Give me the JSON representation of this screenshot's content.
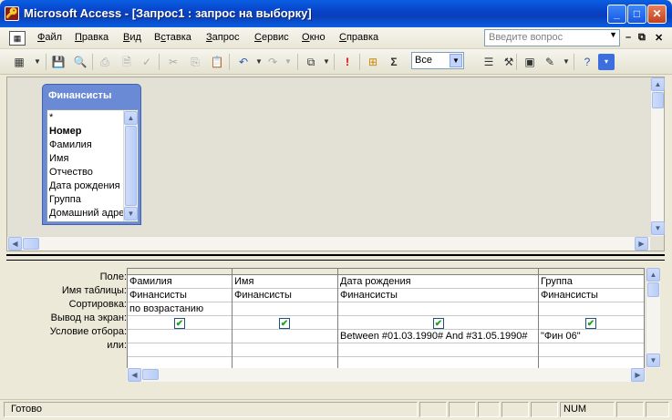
{
  "window": {
    "title": "Microsoft Access - [Запрос1 : запрос на выборку]",
    "app_icon": "access-key-icon"
  },
  "menu": [
    {
      "label": "Файл",
      "u": "Ф",
      "rest": "айл"
    },
    {
      "label": "Правка",
      "u": "П",
      "rest": "равка"
    },
    {
      "label": "Вид",
      "u": "В",
      "rest": "ид"
    },
    {
      "label": "Вставка",
      "u": "с",
      "pre": "В",
      "rest": "тавка"
    },
    {
      "label": "Запрос",
      "u": "З",
      "rest": "апрос"
    },
    {
      "label": "Сервис",
      "u": "С",
      "rest": "ервис"
    },
    {
      "label": "Окно",
      "u": "О",
      "rest": "кно"
    },
    {
      "label": "Справка",
      "u": "С",
      "rest": "правка"
    }
  ],
  "ask_box": {
    "placeholder": "Введите вопрос"
  },
  "toolbar": {
    "top_values": "Все"
  },
  "table": {
    "name": "Финансисты",
    "fields": [
      "*",
      "Номер",
      "Фамилия",
      "Имя",
      "Отчество",
      "Дата рождения",
      "Группа",
      "Домашний адрес"
    ]
  },
  "grid": {
    "row_labels": [
      "Поле:",
      "Имя таблицы:",
      "Сортировка:",
      "Вывод на экран:",
      "Условие отбора:",
      "или:"
    ],
    "columns": [
      {
        "field": "Фамилия",
        "table": "Финансисты",
        "sort": "по возрастанию",
        "show": true,
        "criteria": "",
        "or": ""
      },
      {
        "field": "Имя",
        "table": "Финансисты",
        "sort": "",
        "show": true,
        "criteria": "",
        "or": ""
      },
      {
        "field": "Дата рождения",
        "table": "Финансисты",
        "sort": "",
        "show": true,
        "criteria": "Between #01.03.1990# And #31.05.1990#",
        "or": ""
      },
      {
        "field": "Группа",
        "table": "Финансисты",
        "sort": "",
        "show": true,
        "criteria": "\"Фин 06\"",
        "or": ""
      }
    ]
  },
  "status": {
    "text": "Готово",
    "num": "NUM"
  }
}
